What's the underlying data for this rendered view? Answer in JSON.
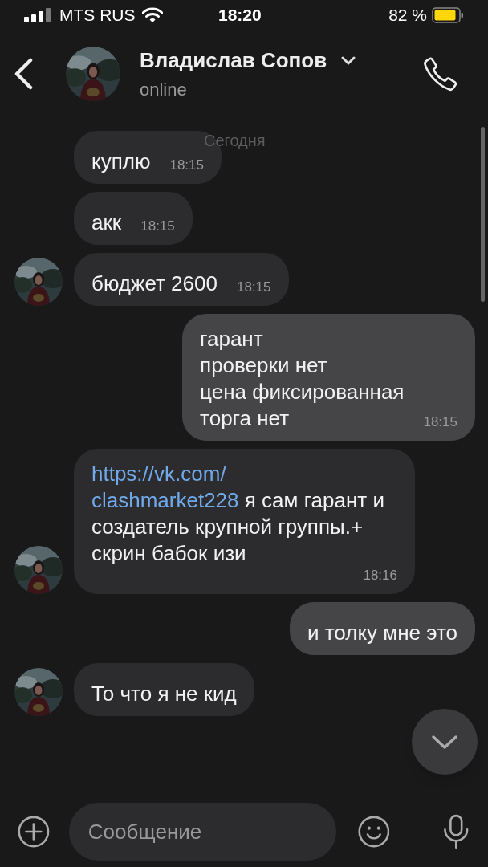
{
  "status_bar": {
    "carrier": "MTS RUS",
    "time": "18:20",
    "battery": "82 %"
  },
  "header": {
    "name": "Владислав Сопов",
    "status": "online"
  },
  "date_label": "Сегодня",
  "messages": [
    {
      "kind": "incoming",
      "avatar": false,
      "text": "куплю",
      "time": "18:15"
    },
    {
      "kind": "incoming",
      "avatar": false,
      "text": "акк",
      "time": "18:15"
    },
    {
      "kind": "incoming",
      "avatar": true,
      "text": "бюджет 2600",
      "time": "18:15"
    },
    {
      "kind": "outgoing",
      "text": "гарант\nпроверки нет\nцена фиксированная\nторга нет",
      "time": "18:15"
    },
    {
      "kind": "incoming",
      "avatar": true,
      "link": "https://vk.com/clashmarket228",
      "text": "я сам гарант и создатель крупной группы.+ скрин бабок изи",
      "time": "18:16"
    },
    {
      "kind": "outgoing",
      "text": "и толку мне это"
    },
    {
      "kind": "incoming",
      "avatar": true,
      "text": "То что я не кид"
    }
  ],
  "input": {
    "placeholder": "Сообщение"
  }
}
